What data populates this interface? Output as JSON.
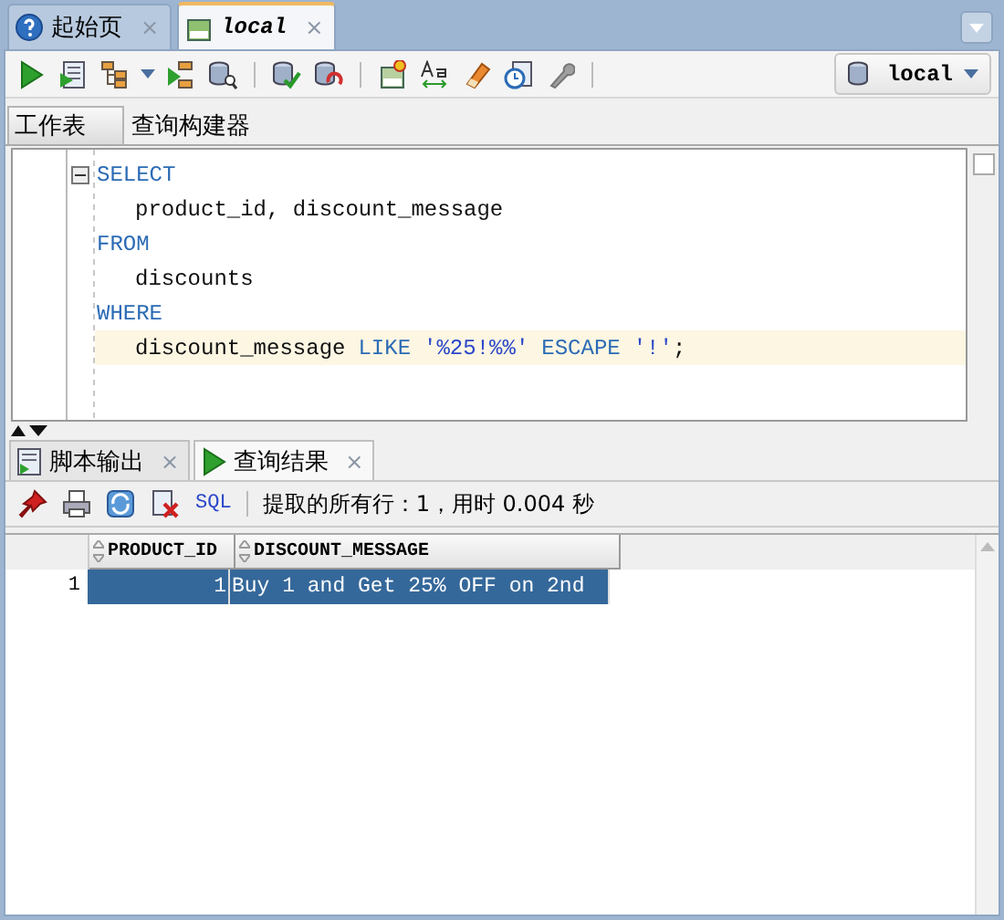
{
  "document_tabs": [
    {
      "label": "起始页",
      "close": "×",
      "selected": false,
      "kind": "help"
    },
    {
      "label": "local",
      "close": "×",
      "selected": true,
      "kind": "sql"
    }
  ],
  "toolbar": {
    "connection": "local"
  },
  "editor_tabs": [
    {
      "label": "工作表",
      "selected": true
    },
    {
      "label": "查询构建器",
      "selected": false
    }
  ],
  "editor": {
    "lines": [
      {
        "indent": false,
        "current": false,
        "fold": true,
        "tokens": [
          {
            "text": "SELECT",
            "kind": "keyword"
          }
        ]
      },
      {
        "indent": true,
        "current": false,
        "fold": false,
        "tokens": [
          {
            "text": "product_id, discount_message",
            "kind": "plain"
          }
        ]
      },
      {
        "indent": false,
        "current": false,
        "fold": false,
        "tokens": [
          {
            "text": "FROM",
            "kind": "keyword"
          }
        ]
      },
      {
        "indent": true,
        "current": false,
        "fold": false,
        "tokens": [
          {
            "text": "discounts",
            "kind": "plain"
          }
        ]
      },
      {
        "indent": false,
        "current": false,
        "fold": false,
        "tokens": [
          {
            "text": "WHERE",
            "kind": "keyword"
          }
        ]
      },
      {
        "indent": true,
        "current": true,
        "fold": false,
        "tokens": [
          {
            "text": "discount_message",
            "kind": "plain"
          },
          {
            "text": "LIKE",
            "kind": "keyword"
          },
          {
            "text": "'%25!%%'",
            "kind": "string"
          },
          {
            "text": "ESCAPE",
            "kind": "keyword"
          },
          {
            "text": "'!'",
            "kind": "string"
          },
          {
            "text": ";",
            "kind": "punct"
          }
        ]
      }
    ]
  },
  "output_tabs": [
    {
      "label": "脚本输出",
      "close": "×",
      "selected": false,
      "kind": "script"
    },
    {
      "label": "查询结果",
      "close": "×",
      "selected": true,
      "kind": "run"
    }
  ],
  "result_toolbar": {
    "sql": "SQL",
    "status": "提取的所有行：1，用时 0.004 秒"
  },
  "grid": {
    "columns": [
      "PRODUCT_ID",
      "DISCOUNT_MESSAGE"
    ],
    "rows": [
      {
        "number": "1",
        "selected": true,
        "cells": [
          "1",
          "Buy 1 and Get 25% OFF on 2nd"
        ]
      }
    ]
  }
}
